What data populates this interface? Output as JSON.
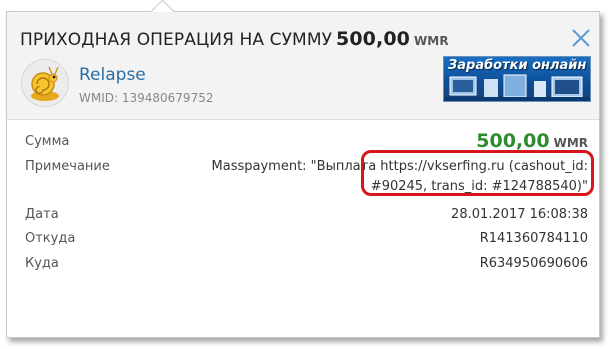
{
  "dialog": {
    "title_prefix": "ПРИХОДНАЯ ОПЕРАЦИЯ НА СУММУ",
    "title_amount": "500,00",
    "title_currency": "WMR",
    "close_icon": "close-icon",
    "accent_color": "#2a6ea6"
  },
  "sender": {
    "name": "Relapse",
    "wmid": "WMID: 139480679752",
    "avatar_icon": "snail-avatar-icon"
  },
  "banner": {
    "text": "Заработки онлайн"
  },
  "details": {
    "sum_label": "Сумма",
    "sum_value": "500,00",
    "sum_currency": "WMR",
    "sum_color": "#2e8b2e",
    "note_label": "Примечание",
    "note_line1": "Masspayment: \"Выплата https://vkserfing.ru (cashout_id:",
    "note_line2": "#90245, trans_id: #124788540)\"",
    "date_label": "Дата",
    "date_value": "28.01.2017 16:08:38",
    "from_label": "Откуда",
    "from_value": "R141360784110",
    "to_label": "Куда",
    "to_value": "R634950690606"
  }
}
